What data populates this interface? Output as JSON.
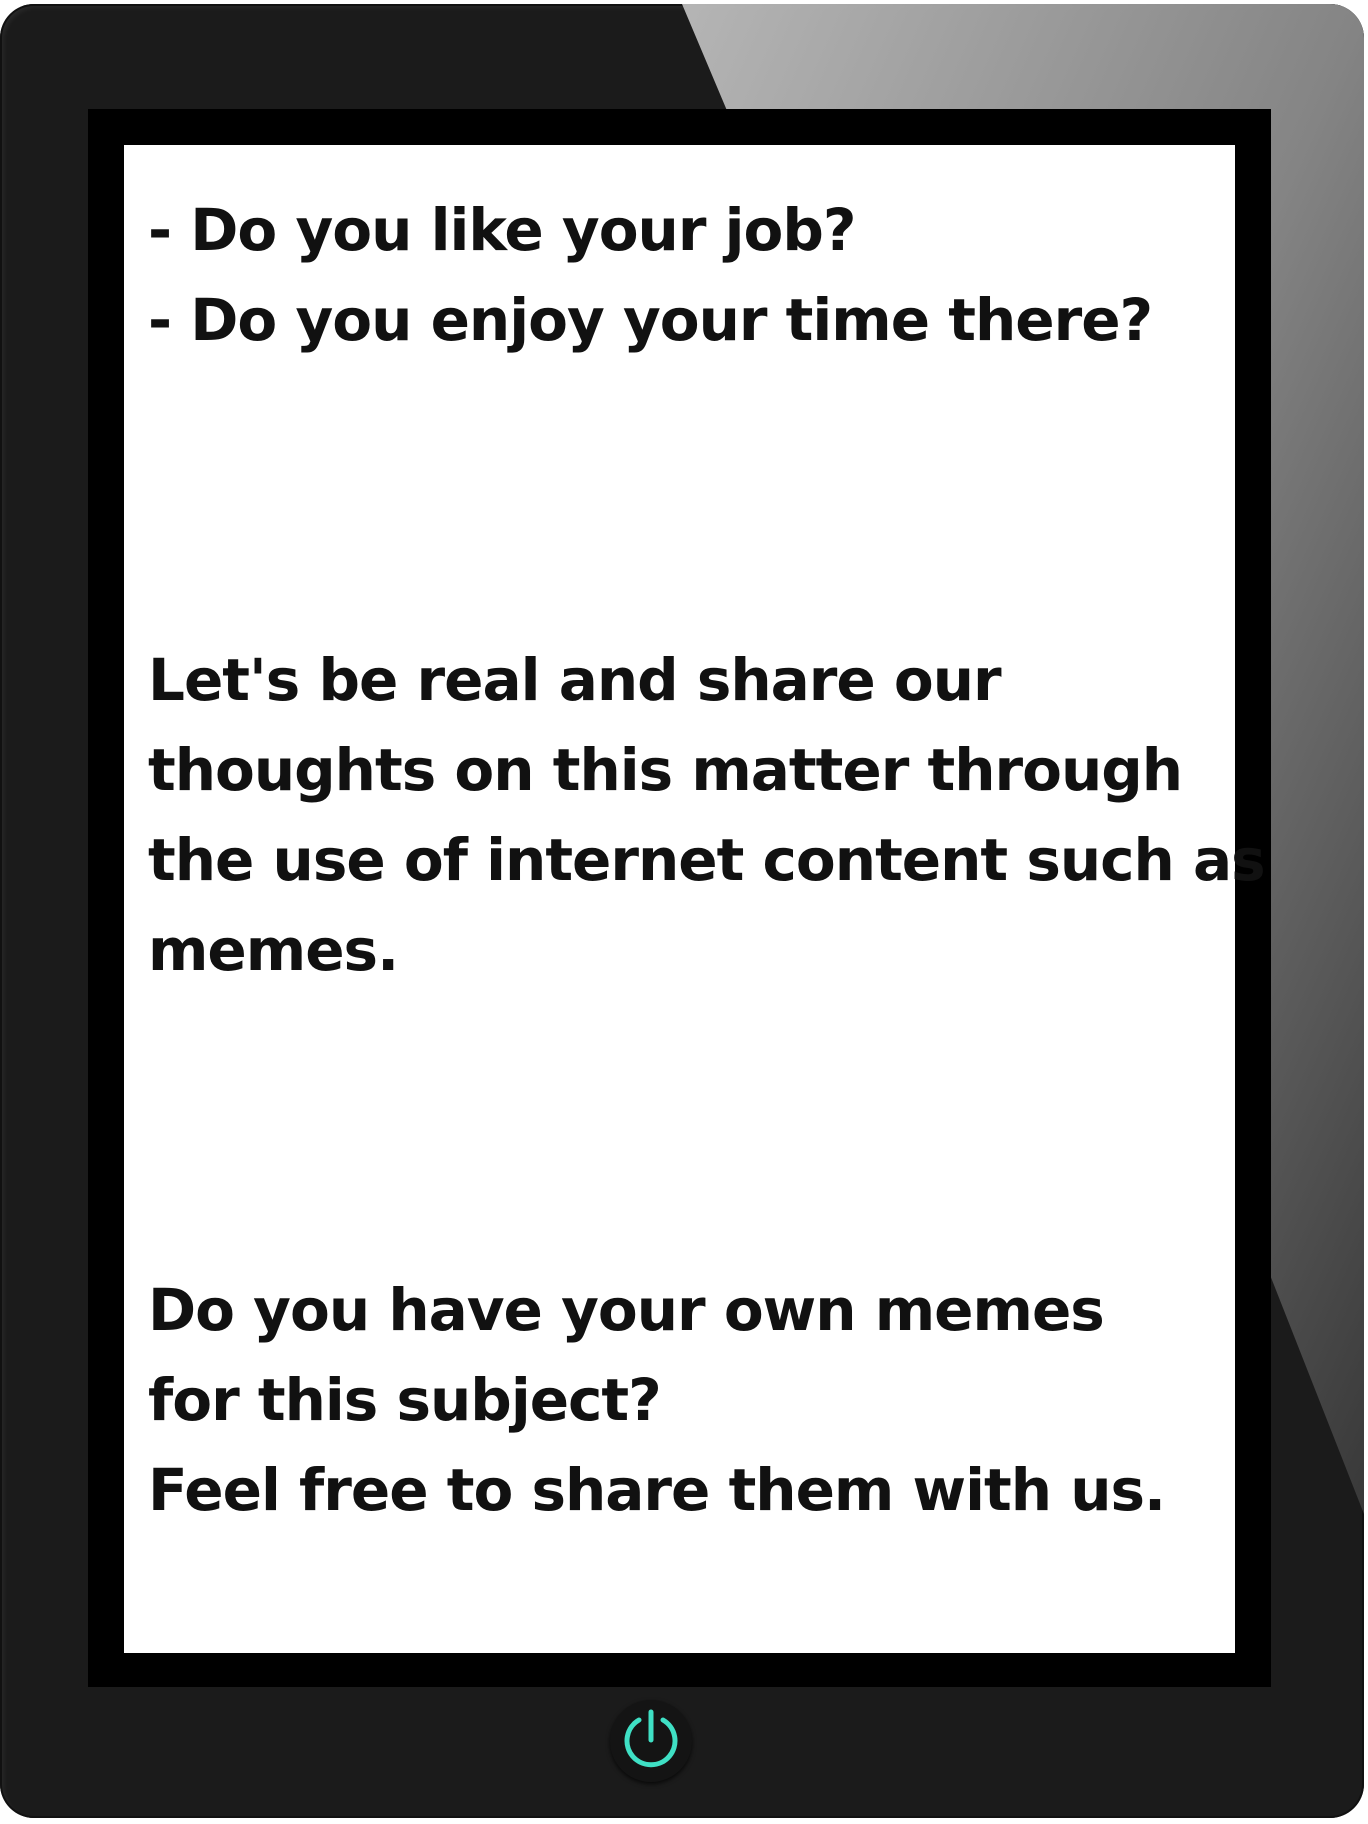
{
  "screen": {
    "question_1": "- Do you like your job?",
    "question_2": "- Do you enjoy your time there?",
    "paragraph_lines": [
      "Let's be real and share our",
      "thoughts on this matter through",
      "the use of internet content such as",
      "memes."
    ],
    "closing_lines": [
      "Do you have your own memes",
      "for this subject?",
      "Feel free to share them with us."
    ]
  },
  "device": {
    "power_icon": "power-icon",
    "power_color": "#3fe0c5",
    "body_color": "#1b1b1b",
    "bezel_color": "#000000"
  }
}
